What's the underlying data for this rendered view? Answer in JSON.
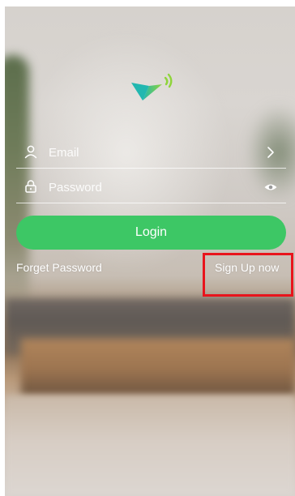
{
  "login": {
    "email_placeholder": "Email",
    "password_placeholder": "Password",
    "login_label": "Login",
    "forget_password_label": "Forget Password",
    "sign_up_label": "Sign Up now"
  },
  "icons": {
    "logo": "brand-logo-icon",
    "email": "user-icon",
    "password": "lock-icon",
    "email_trailing": "chevron-right-icon",
    "password_trailing": "eye-icon"
  },
  "colors": {
    "accent": "#3dc765",
    "highlight": "#e8141c",
    "logo_teal": "#22b7b0",
    "logo_green": "#8fd43a"
  }
}
